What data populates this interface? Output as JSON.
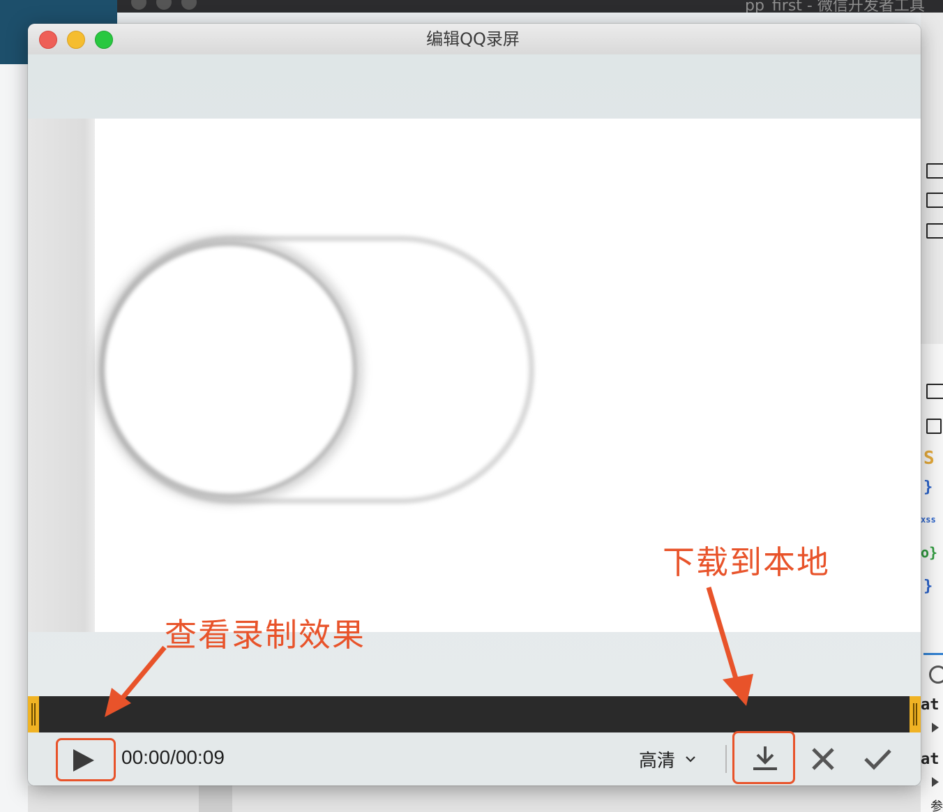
{
  "background": {
    "top_window_title": "pp_first - 微信开发者工具",
    "right_panel_snippets": [
      "S",
      "}",
      "xss",
      "o}",
      "}",
      "at",
      "at",
      "参"
    ]
  },
  "window": {
    "title": "编辑QQ录屏"
  },
  "annotations": {
    "play_note": "查看录制效果",
    "download_note": "下载到本地"
  },
  "controls": {
    "current_time": "00:00",
    "time_separator": "/",
    "total_time": "00:09",
    "quality_label": "高清"
  },
  "colors": {
    "annotation": "#e8532a",
    "trim_handle": "#f0b324",
    "timeline": "#2a2a2a"
  },
  "icons": {
    "play": "play-icon",
    "quality_dropdown": "chevron-down-icon",
    "download": "download-icon",
    "cancel": "close-icon",
    "confirm": "checkmark-icon"
  }
}
